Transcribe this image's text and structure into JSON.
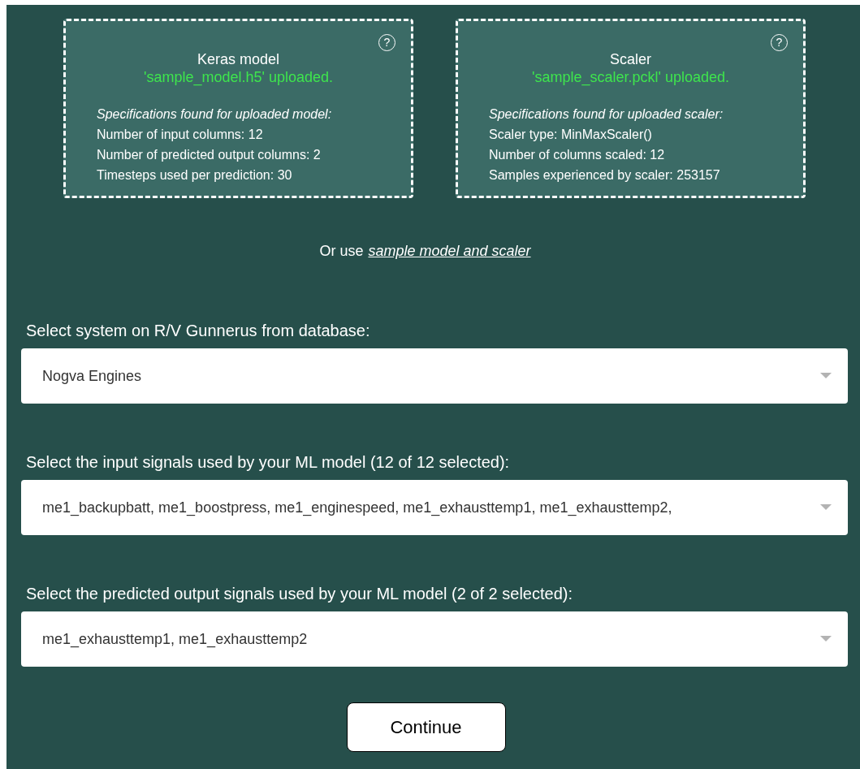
{
  "cards": [
    {
      "title": "Keras model",
      "status": "'sample_model.h5' uploaded.",
      "spec_heading": "Specifications found for uploaded model:",
      "specs": [
        "Number of input columns: 12",
        "Number of predicted output columns: 2",
        "Timesteps used per prediction: 30"
      ],
      "help": "?"
    },
    {
      "title": "Scaler",
      "status": "'sample_scaler.pckl' uploaded.",
      "spec_heading": "Specifications found for uploaded scaler:",
      "specs": [
        "Scaler type: MinMaxScaler()",
        "Number of columns scaled: 12",
        "Samples experienced by scaler: 253157"
      ],
      "help": "?"
    }
  ],
  "sample_prompt": {
    "text": "Or use",
    "link": "sample model and scaler"
  },
  "selects": [
    {
      "label": "Select system on R/V Gunnerus from database:",
      "value": "Nogva Engines"
    },
    {
      "label": "Select the input signals used by your ML model (12 of 12 selected):",
      "value": "me1_backupbatt, me1_boostpress, me1_enginespeed, me1_exhausttemp1, me1_exhausttemp2,"
    },
    {
      "label": "Select the predicted output signals used by your ML model (2 of 2 selected):",
      "value": "me1_exhausttemp1, me1_exhausttemp2"
    }
  ],
  "continue_button": "Continue"
}
